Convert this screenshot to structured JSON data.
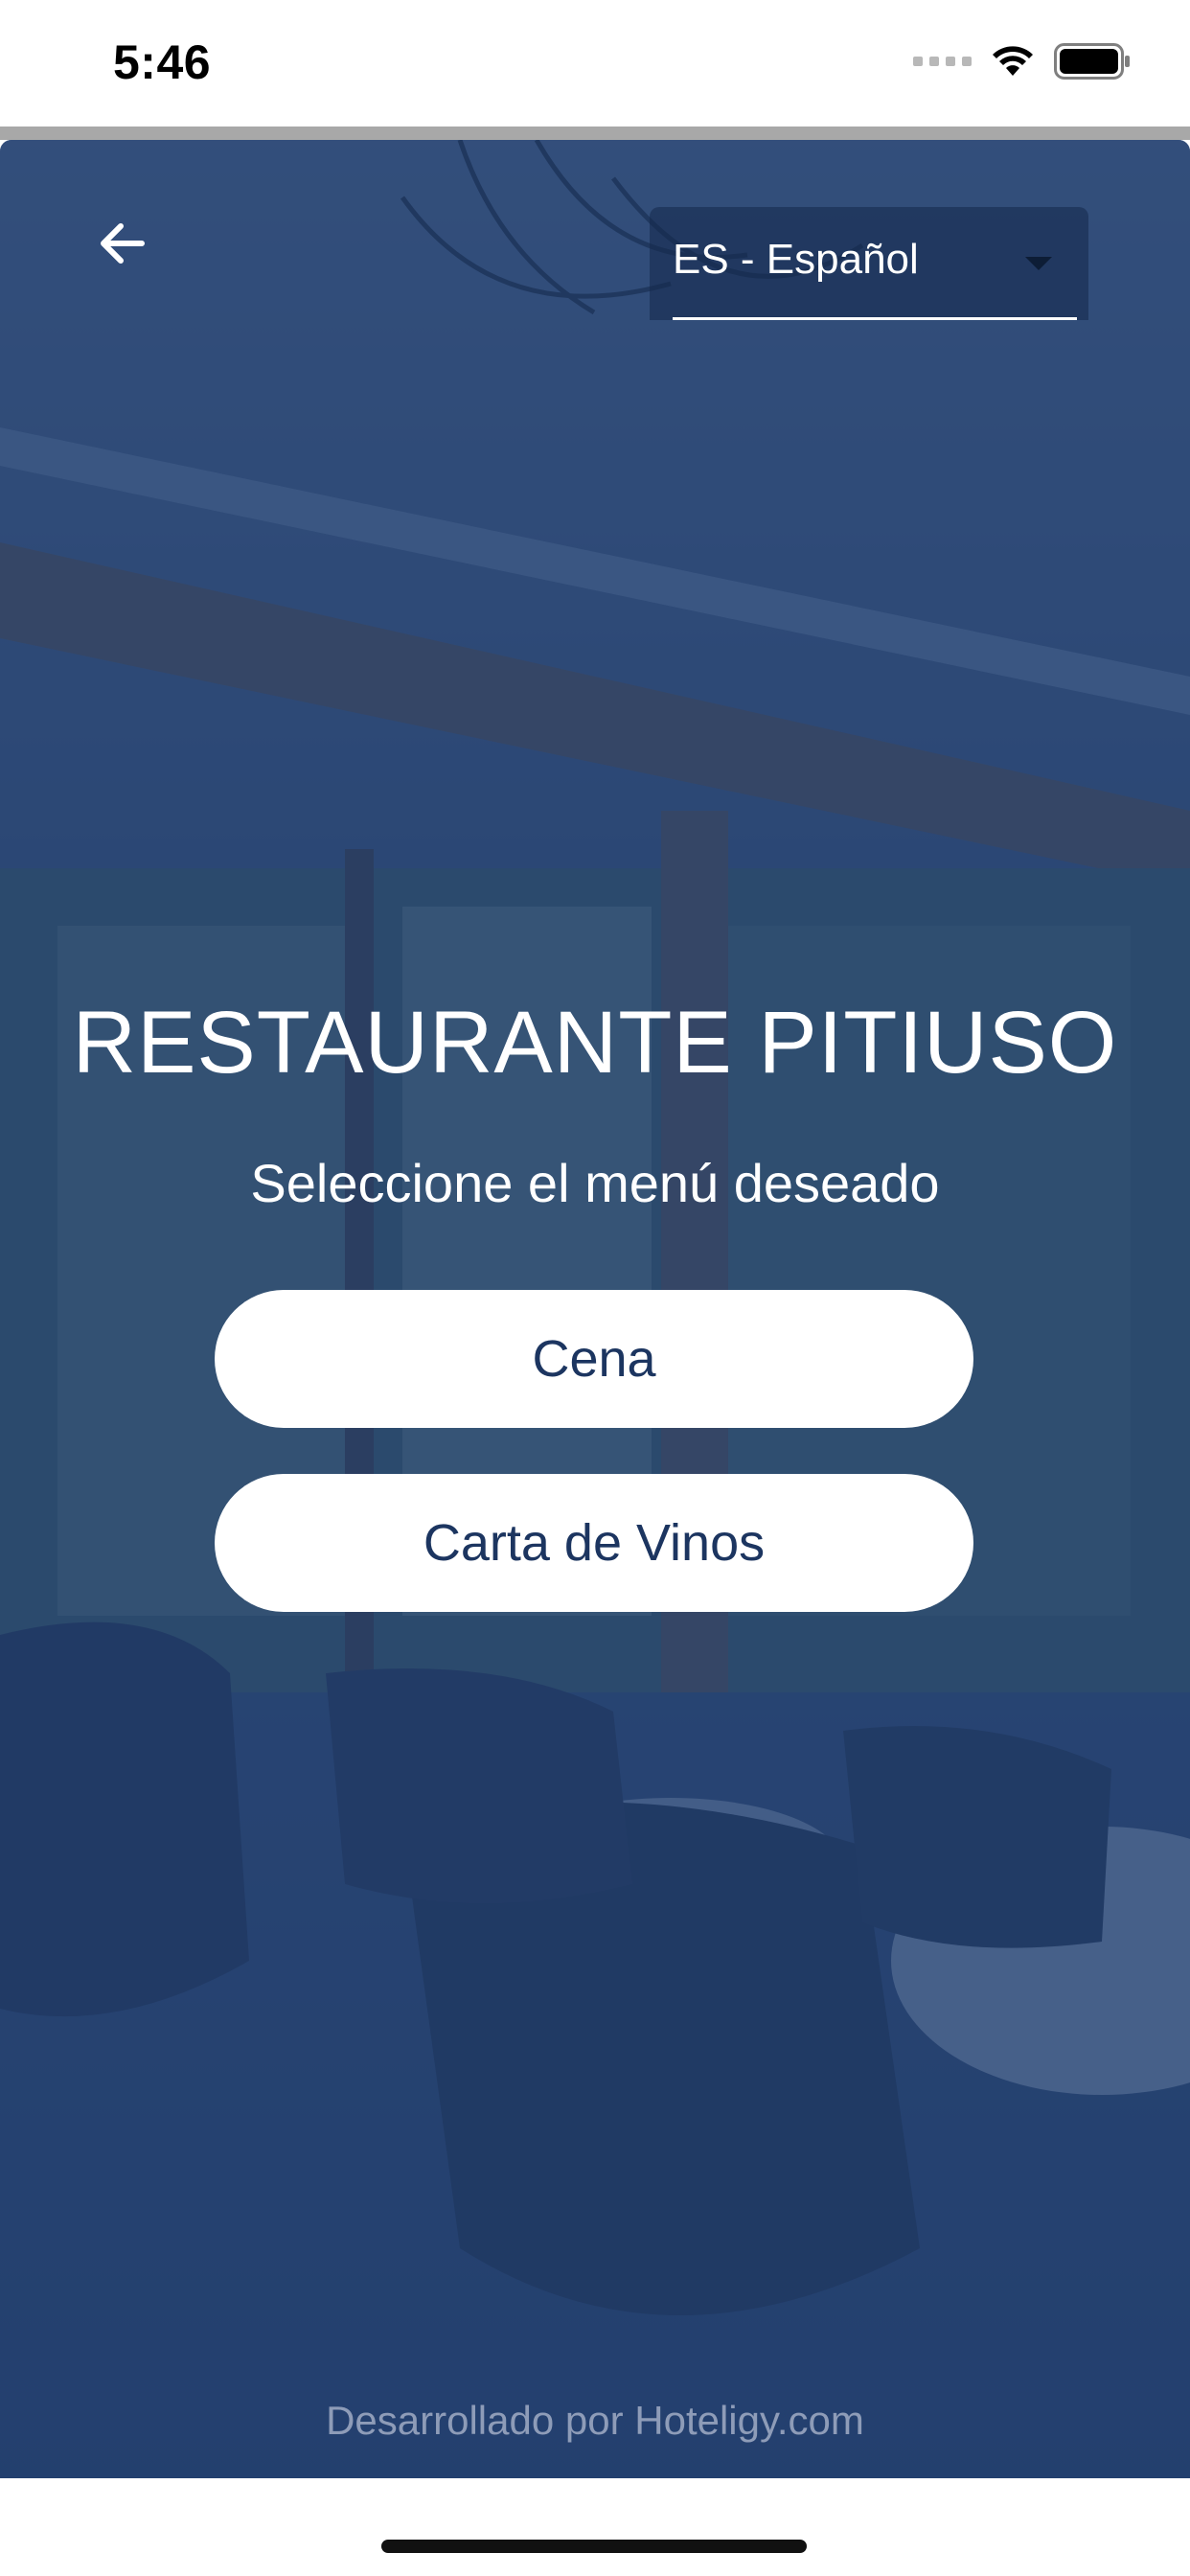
{
  "status_bar": {
    "time": "5:46"
  },
  "header": {
    "back_icon": "arrow-left-icon",
    "language_select": {
      "selected": "ES - Español",
      "icon": "caret-down-icon"
    }
  },
  "main": {
    "title": "RESTAURANTE PITIUSO",
    "subtitle": "Seleccione el menú deseado",
    "menu_buttons": [
      {
        "label": "Cena"
      },
      {
        "label": "Carta de Vinos"
      }
    ]
  },
  "footer": {
    "credit": "Desarrollado por Hoteligy.com"
  },
  "colors": {
    "overlay": "#1e3c6e",
    "button_text": "#1c3560",
    "button_bg": "#ffffff",
    "footer_text": "#8e9cb8"
  }
}
